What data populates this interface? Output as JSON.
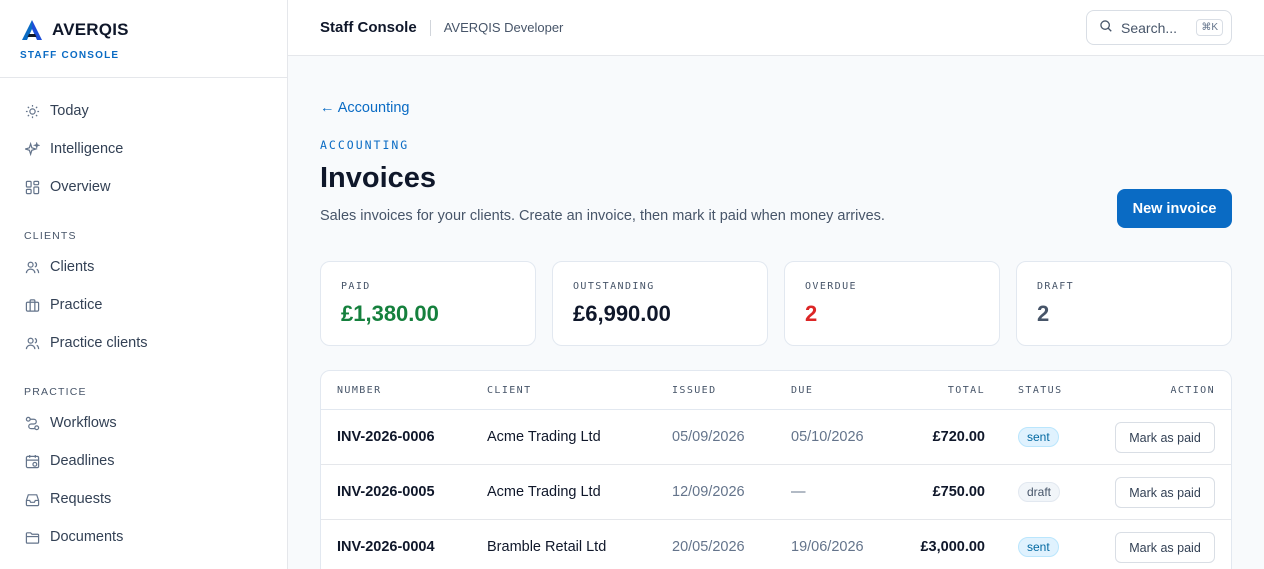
{
  "brand": {
    "name": "AVERQIS",
    "subtitle": "STAFF CONSOLE",
    "accent": "#0a6bc4"
  },
  "sidebar": {
    "items": [
      {
        "label": "Today",
        "icon": "sun-icon"
      },
      {
        "label": "Intelligence",
        "icon": "sparkles-icon"
      },
      {
        "label": "Overview",
        "icon": "grid-icon"
      }
    ],
    "sections": [
      {
        "title": "CLIENTS",
        "items": [
          {
            "label": "Clients",
            "icon": "users-icon"
          },
          {
            "label": "Practice",
            "icon": "briefcase-icon"
          },
          {
            "label": "Practice clients",
            "icon": "users-icon"
          }
        ]
      },
      {
        "title": "PRACTICE",
        "items": [
          {
            "label": "Workflows",
            "icon": "workflow-icon"
          },
          {
            "label": "Deadlines",
            "icon": "calendar-icon"
          },
          {
            "label": "Requests",
            "icon": "inbox-icon"
          },
          {
            "label": "Documents",
            "icon": "folder-icon"
          }
        ]
      }
    ]
  },
  "header": {
    "title": "Staff Console",
    "subtitle": "AVERQIS Developer"
  },
  "search": {
    "placeholder": "Search...",
    "shortcut": "⌘K"
  },
  "page": {
    "back_link": "← Accounting",
    "eyebrow": "ACCOUNTING",
    "title": "Invoices",
    "description": "Sales invoices for your clients. Create an invoice, then mark it paid when money arrives.",
    "new_button": "New invoice"
  },
  "stats": [
    {
      "label": "PAID",
      "value": "£1,380.00",
      "color": "#15803d"
    },
    {
      "label": "OUTSTANDING",
      "value": "£6,990.00",
      "color": "#0f172a"
    },
    {
      "label": "OVERDUE",
      "value": "2",
      "color": "#dc2626"
    },
    {
      "label": "DRAFT",
      "value": "2",
      "color": "#475569"
    }
  ],
  "table": {
    "columns": [
      "NUMBER",
      "CLIENT",
      "ISSUED",
      "DUE",
      "TOTAL",
      "STATUS",
      "ACTION"
    ],
    "rows": [
      {
        "number": "INV-2026-0006",
        "client": "Acme Trading Ltd",
        "issued": "05/09/2026",
        "due": "05/10/2026",
        "total": "£720.00",
        "status": "sent",
        "action": "Mark as paid"
      },
      {
        "number": "INV-2026-0005",
        "client": "Acme Trading Ltd",
        "issued": "12/09/2026",
        "due": "—",
        "total": "£750.00",
        "status": "draft",
        "action": "Mark as paid"
      },
      {
        "number": "INV-2026-0004",
        "client": "Bramble Retail Ltd",
        "issued": "20/05/2026",
        "due": "19/06/2026",
        "total": "£3,000.00",
        "status": "sent",
        "action": "Mark as paid"
      }
    ]
  }
}
